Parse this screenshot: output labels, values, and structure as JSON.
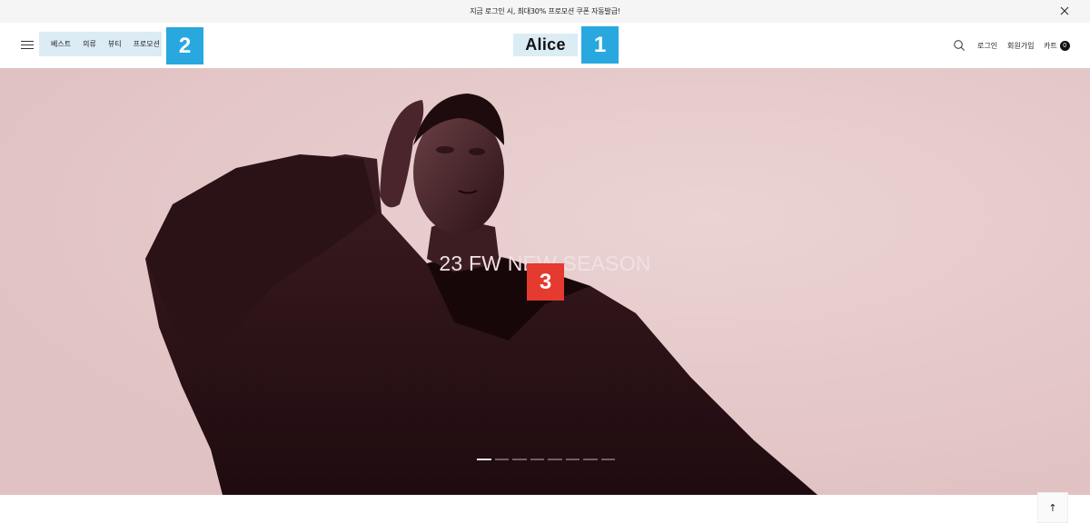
{
  "promo": {
    "text": "지금 로그인 시, 최대30% 프로모션 쿠폰 자동발급!",
    "close_icon": "close-icon"
  },
  "header": {
    "menu_icon": "hamburger-icon",
    "nav": [
      "베스트",
      "의류",
      "뷰티",
      "프로모션"
    ],
    "logo": "Alice",
    "search_icon": "search-icon",
    "login": "로그인",
    "join": "회원가입",
    "cart": "카트",
    "cart_count": "0"
  },
  "markers": {
    "m1": "1",
    "m2": "2",
    "m3": "3"
  },
  "hero": {
    "title": "23 FW NEW SEASON",
    "slide_count": 8,
    "active_slide": 1,
    "background_color": "#e3c6c7"
  },
  "scroll_top": {
    "label": "↑"
  },
  "colors": {
    "marker_blue": "#29a8e0",
    "marker_red": "#e43a2f",
    "highlight": "#dcecf5"
  }
}
